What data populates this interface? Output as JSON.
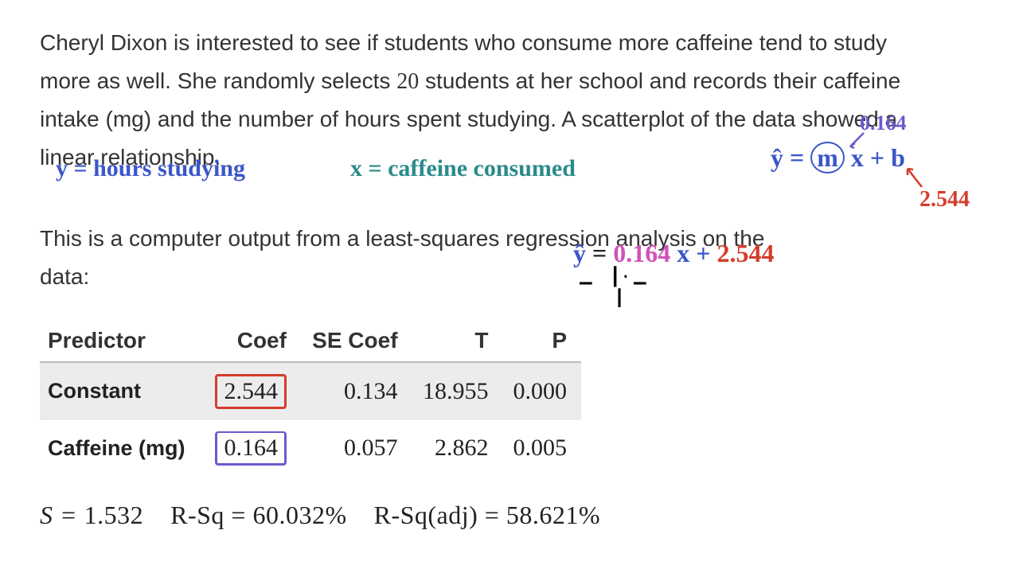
{
  "paragraph1_a": "Cheryl Dixon is interested to see if students who consume more caffeine tend to study more as well. She randomly selects ",
  "paragraph1_num": "20",
  "paragraph1_b": " students at her school and records their caffeine intake (mg) and the number of hours spent studying. A scatterplot of the data showed a linear relationship.",
  "paragraph2": "This is a computer output from a least-squares regression analysis on the data:",
  "hand_y": "y = hours studying",
  "hand_x": "x = caffeine consumed",
  "hand_eq_base": "ŷ = m x + b",
  "hand_eq_base_y": "ŷ",
  "hand_eq_base_eq": " = ",
  "hand_eq_base_m": "m",
  "hand_eq_base_x": "x + ",
  "hand_eq_base_b": "b",
  "hand_slope": "0.164",
  "hand_intercept": "2.544",
  "hand_eq2_y": "ŷ",
  "hand_eq2_eq": " = ",
  "hand_eq2_slope": "0.164",
  "hand_eq2_x": " x + ",
  "hand_eq2_b": "2.544",
  "chart_data": {
    "type": "table",
    "columns": [
      "Predictor",
      "Coef",
      "SE Coef",
      "T",
      "P"
    ],
    "rows": [
      {
        "predictor": "Constant",
        "coef": "2.544",
        "se": "0.134",
        "t": "18.955",
        "p": "0.000"
      },
      {
        "predictor": "Caffeine (mg)",
        "coef": "0.164",
        "se": "0.057",
        "t": "2.862",
        "p": "0.005"
      }
    ],
    "stats": {
      "S": "1.532",
      "R-Sq": "60.032%",
      "R-Sq(adj)": "58.621%"
    }
  },
  "stats_line_s_label": "S = ",
  "stats_line_rsq_label": "R-Sq = ",
  "stats_line_rsqa_label": "R-Sq(adj) = "
}
